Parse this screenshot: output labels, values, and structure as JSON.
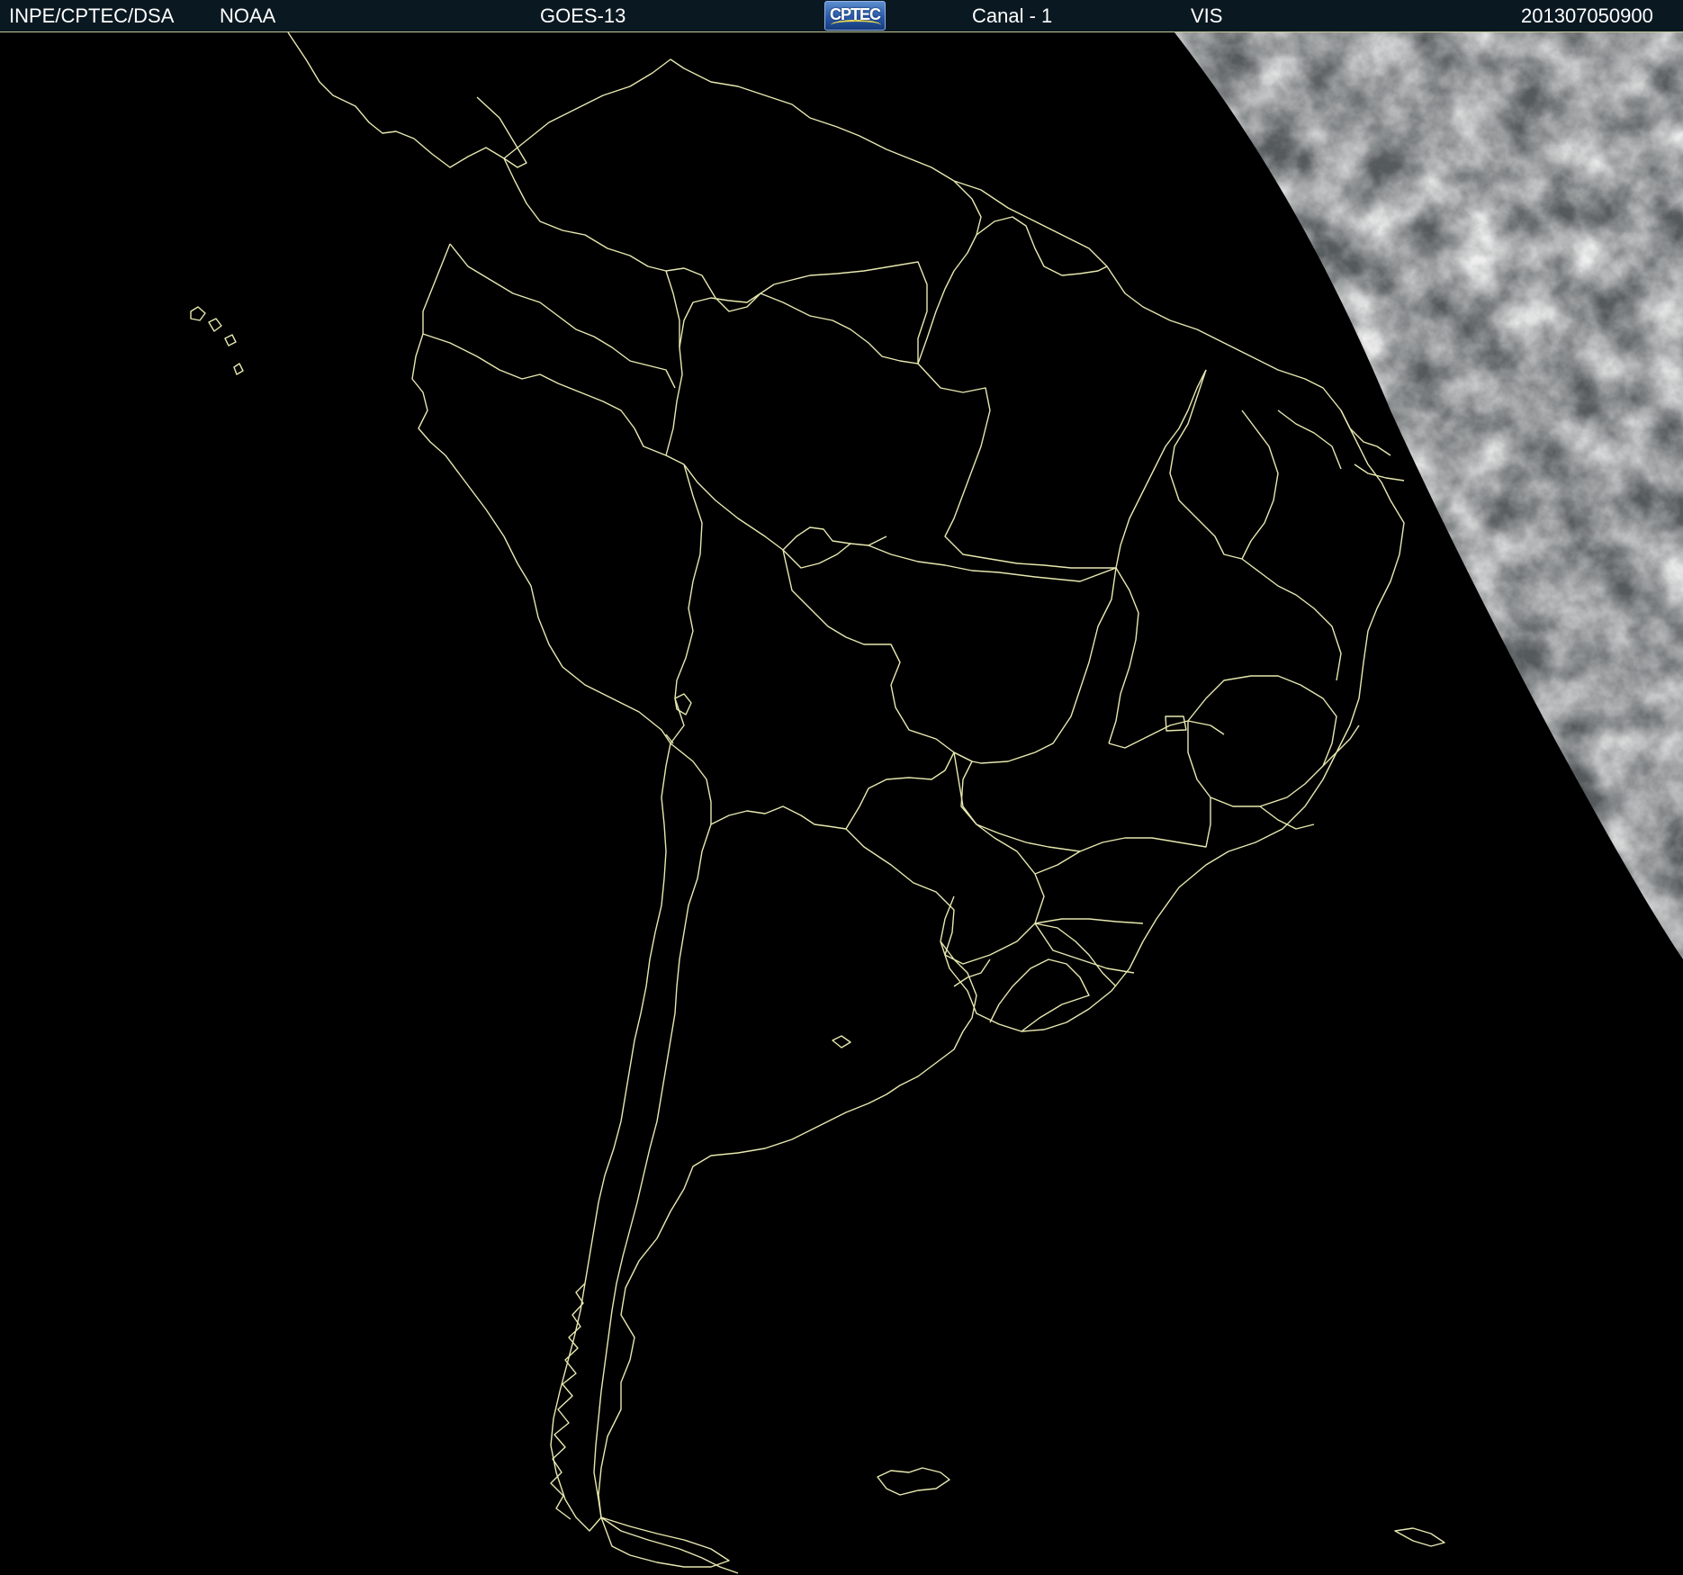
{
  "header": {
    "org_label": "INPE/CPTEC/DSA",
    "agency_label": "NOAA",
    "satellite_label": "GOES-13",
    "logo_text": "CPTEC",
    "channel_label": "Canal - 1",
    "band_label": "VIS",
    "timestamp": "201307050900"
  },
  "map": {
    "background_color": "#000000",
    "outline_color": "#e8e8b0",
    "cloud_color": "#cfcfcf",
    "terminator_side": "east",
    "features": [
      "south-america-coastline",
      "country-borders",
      "brazil-state-borders",
      "daylit-cloud-region"
    ]
  }
}
